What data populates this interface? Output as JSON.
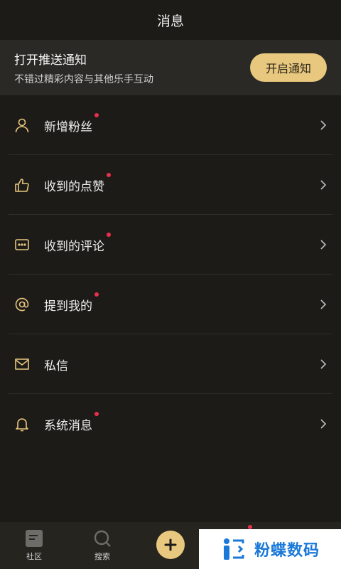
{
  "header": {
    "title": "消息"
  },
  "banner": {
    "title": "打开推送通知",
    "subtitle": "不错过精彩内容与其他乐手互动",
    "button_label": "开启通知"
  },
  "list": {
    "items": [
      {
        "label": "新增粉丝",
        "icon": "user-icon",
        "badge": true
      },
      {
        "label": "收到的点赞",
        "icon": "thumbs-up-icon",
        "badge": true
      },
      {
        "label": "收到的评论",
        "icon": "comment-icon",
        "badge": true
      },
      {
        "label": "提到我的",
        "icon": "at-icon",
        "badge": true
      },
      {
        "label": "私信",
        "icon": "envelope-icon",
        "badge": false
      },
      {
        "label": "系统消息",
        "icon": "bell-icon",
        "badge": true
      }
    ]
  },
  "tabbar": {
    "tabs": [
      {
        "label": "社区",
        "icon": "community-icon"
      },
      {
        "label": "搜索",
        "icon": "search-icon"
      }
    ],
    "add_icon": "plus-icon"
  },
  "watermark": {
    "text": "粉蝶数码"
  },
  "colors": {
    "background": "#1d1b18",
    "banner_bg": "#2b2926",
    "accent": "#e8c77e",
    "badge": "#e8304a",
    "tabbar_bg": "#26241f"
  }
}
